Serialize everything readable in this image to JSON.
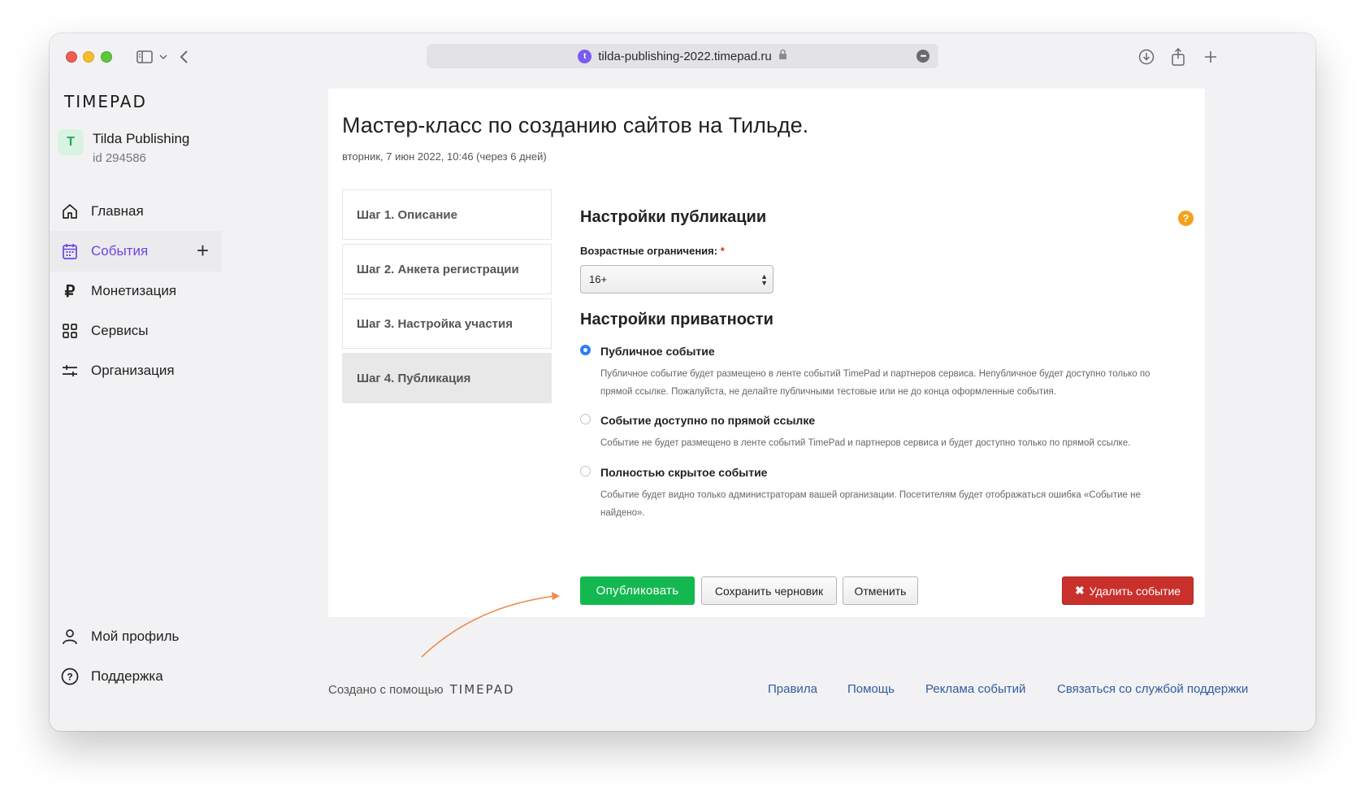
{
  "browser": {
    "url": "tilda-publishing-2022.timepad.ru"
  },
  "sidebar": {
    "logo": "TIMEPAD",
    "org": {
      "avatar": "T",
      "name": "Tilda Publishing",
      "id": "id 294586"
    },
    "items": [
      {
        "label": "Главная",
        "icon": "home-icon"
      },
      {
        "label": "События",
        "icon": "calendar-icon",
        "active": true
      },
      {
        "label": "Монетизация",
        "icon": "ruble-icon"
      },
      {
        "label": "Сервисы",
        "icon": "grid-icon"
      },
      {
        "label": "Организация",
        "icon": "sliders-icon"
      }
    ],
    "bottom": [
      {
        "label": "Мой профиль",
        "icon": "user-icon"
      },
      {
        "label": "Поддержка",
        "icon": "help-circle-icon"
      }
    ]
  },
  "event": {
    "title": "Мастер-класс по созданию сайтов на Тильде.",
    "date": "вторник, 7 июн 2022, 10:46 (через 6 дней)"
  },
  "steps": [
    "Шаг 1. Описание",
    "Шаг 2. Анкета регистрации",
    "Шаг 3. Настройка участия",
    "Шаг 4. Публикация"
  ],
  "publication": {
    "heading": "Настройки публикации",
    "age_label": "Возрастные ограничения:",
    "required_mark": "*",
    "age_value": "16+"
  },
  "privacy": {
    "heading": "Настройки приватности",
    "options": [
      {
        "label": "Публичное событие",
        "desc1": "Публичное событие будет размещено в ленте событий TimePad и партнеров сервиса. Непубличное будет доступно только по",
        "desc2": "прямой ссылке. Пожалуйста, не делайте публичными тестовые или не до конца оформленные события.",
        "selected": true
      },
      {
        "label": "Событие доступно по прямой ссылке",
        "desc1": "Событие не будет размещено в ленте событий TimePad и партнеров сервиса и будет доступно только по прямой ссылке.",
        "desc2": "",
        "selected": false
      },
      {
        "label": "Полностью скрытое событие",
        "desc1": "Событие будет видно только администраторам вашей организации. Посетителям будет отображаться ошибка «Событие не",
        "desc2": "найдено».",
        "selected": false
      }
    ]
  },
  "actions": {
    "publish": "Опубликовать",
    "draft": "Сохранить черновик",
    "cancel": "Отменить",
    "delete_icon": "✖",
    "delete": "Удалить событие"
  },
  "footer": {
    "made_with": "Создано с помощью",
    "logo": "TIMEPAD",
    "links": [
      "Правила",
      "Помощь",
      "Реклама событий",
      "Связаться со службой поддержки"
    ]
  },
  "colors": {
    "accent": "#6a45e0",
    "publish": "#14b850",
    "delete": "#c9302c",
    "annotation_arrow": "#f08a4b"
  }
}
